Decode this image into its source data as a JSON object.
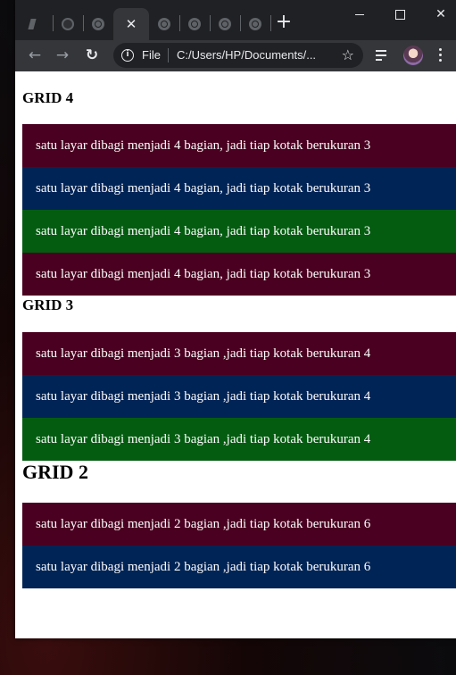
{
  "browser": {
    "tabs": [
      {
        "icon": "pen-icon",
        "active": false
      },
      {
        "icon": "github-icon",
        "active": false
      },
      {
        "icon": "globe-icon",
        "active": false
      },
      {
        "icon": "close-icon",
        "active": true
      },
      {
        "icon": "globe-icon",
        "active": false
      },
      {
        "icon": "globe-icon",
        "active": false
      },
      {
        "icon": "globe-icon",
        "active": false
      },
      {
        "icon": "globe-icon",
        "active": false
      }
    ],
    "active_tab_close": "✕",
    "new_tab": "+",
    "window_close": "✕",
    "back": "←",
    "forward": "→",
    "reload": "↻",
    "info": "i",
    "scheme": "File",
    "url": "C:/Users/HP/Documents/...",
    "star": "☆",
    "colors": {
      "frame": "#202124",
      "toolbar": "#35363a",
      "omnibox": "#202124",
      "text": "#e8eaed"
    }
  },
  "page": {
    "grid4": {
      "heading": "GRID 4",
      "rows": [
        "satu layar dibagi menjadi 4 bagian, jadi tiap kotak berukuran 3",
        "satu layar dibagi menjadi 4 bagian, jadi tiap kotak berukuran 3",
        "satu layar dibagi menjadi 4 bagian, jadi tiap kotak berukuran 3",
        "satu layar dibagi menjadi 4 bagian, jadi tiap kotak berukuran 3"
      ]
    },
    "grid3": {
      "heading": "GRID 3",
      "rows": [
        "satu layar dibagi menjadi 3 bagian ,jadi tiap kotak berukuran 4",
        "satu layar dibagi menjadi 3 bagian ,jadi tiap kotak berukuran 4",
        "satu layar dibagi menjadi 3 bagian ,jadi tiap kotak berukuran 4"
      ]
    },
    "grid2": {
      "heading": "GRID 2",
      "rows": [
        "satu layar dibagi menjadi 2 bagian ,jadi tiap kotak berukuran 6",
        "satu layar dibagi menjadi 2 bagian ,jadi tiap kotak berukuran 6"
      ]
    },
    "colors": {
      "maroon": "#4a0020",
      "navy": "#012456",
      "green": "#045c11"
    }
  }
}
